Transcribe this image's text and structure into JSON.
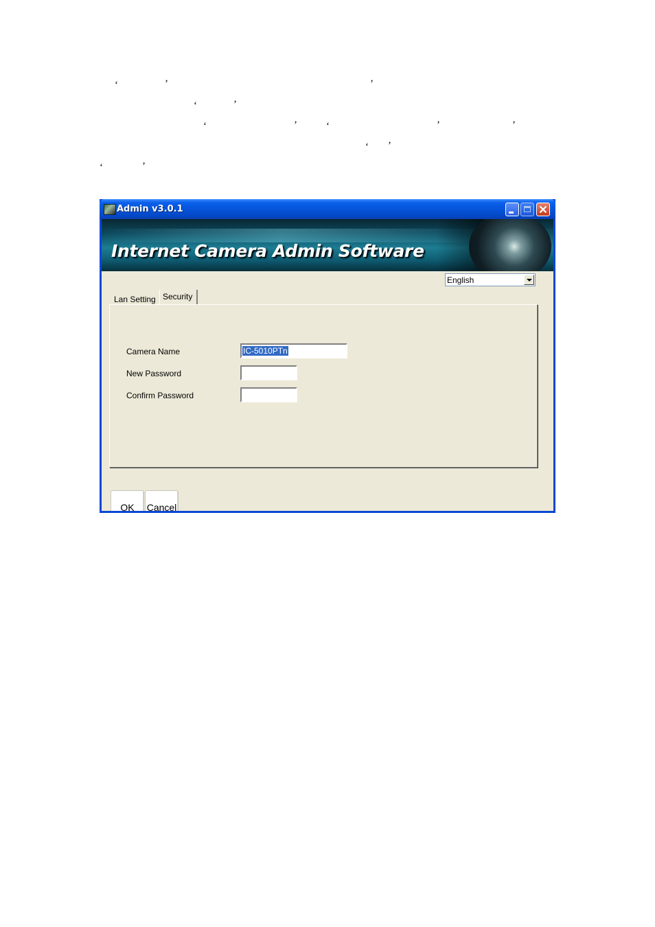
{
  "window": {
    "title": "Admin v3.0.1",
    "banner_title": "Internet Camera Admin Software"
  },
  "language": {
    "selected": "English"
  },
  "tabs": [
    {
      "label": "Lan Setting",
      "active": false
    },
    {
      "label": "Security",
      "active": true
    }
  ],
  "security": {
    "camera_name_label": "Camera Name",
    "camera_name_value": "IC-5010PTn",
    "new_password_label": "New Password",
    "new_password_value": "",
    "confirm_password_label": "Confirm Password",
    "confirm_password_value": ""
  },
  "buttons": {
    "ok": "OK",
    "cancel": "Cancel"
  },
  "colors": {
    "titlebar": "#0a5fea",
    "face": "#ece9d8",
    "selection": "#316ac5"
  }
}
